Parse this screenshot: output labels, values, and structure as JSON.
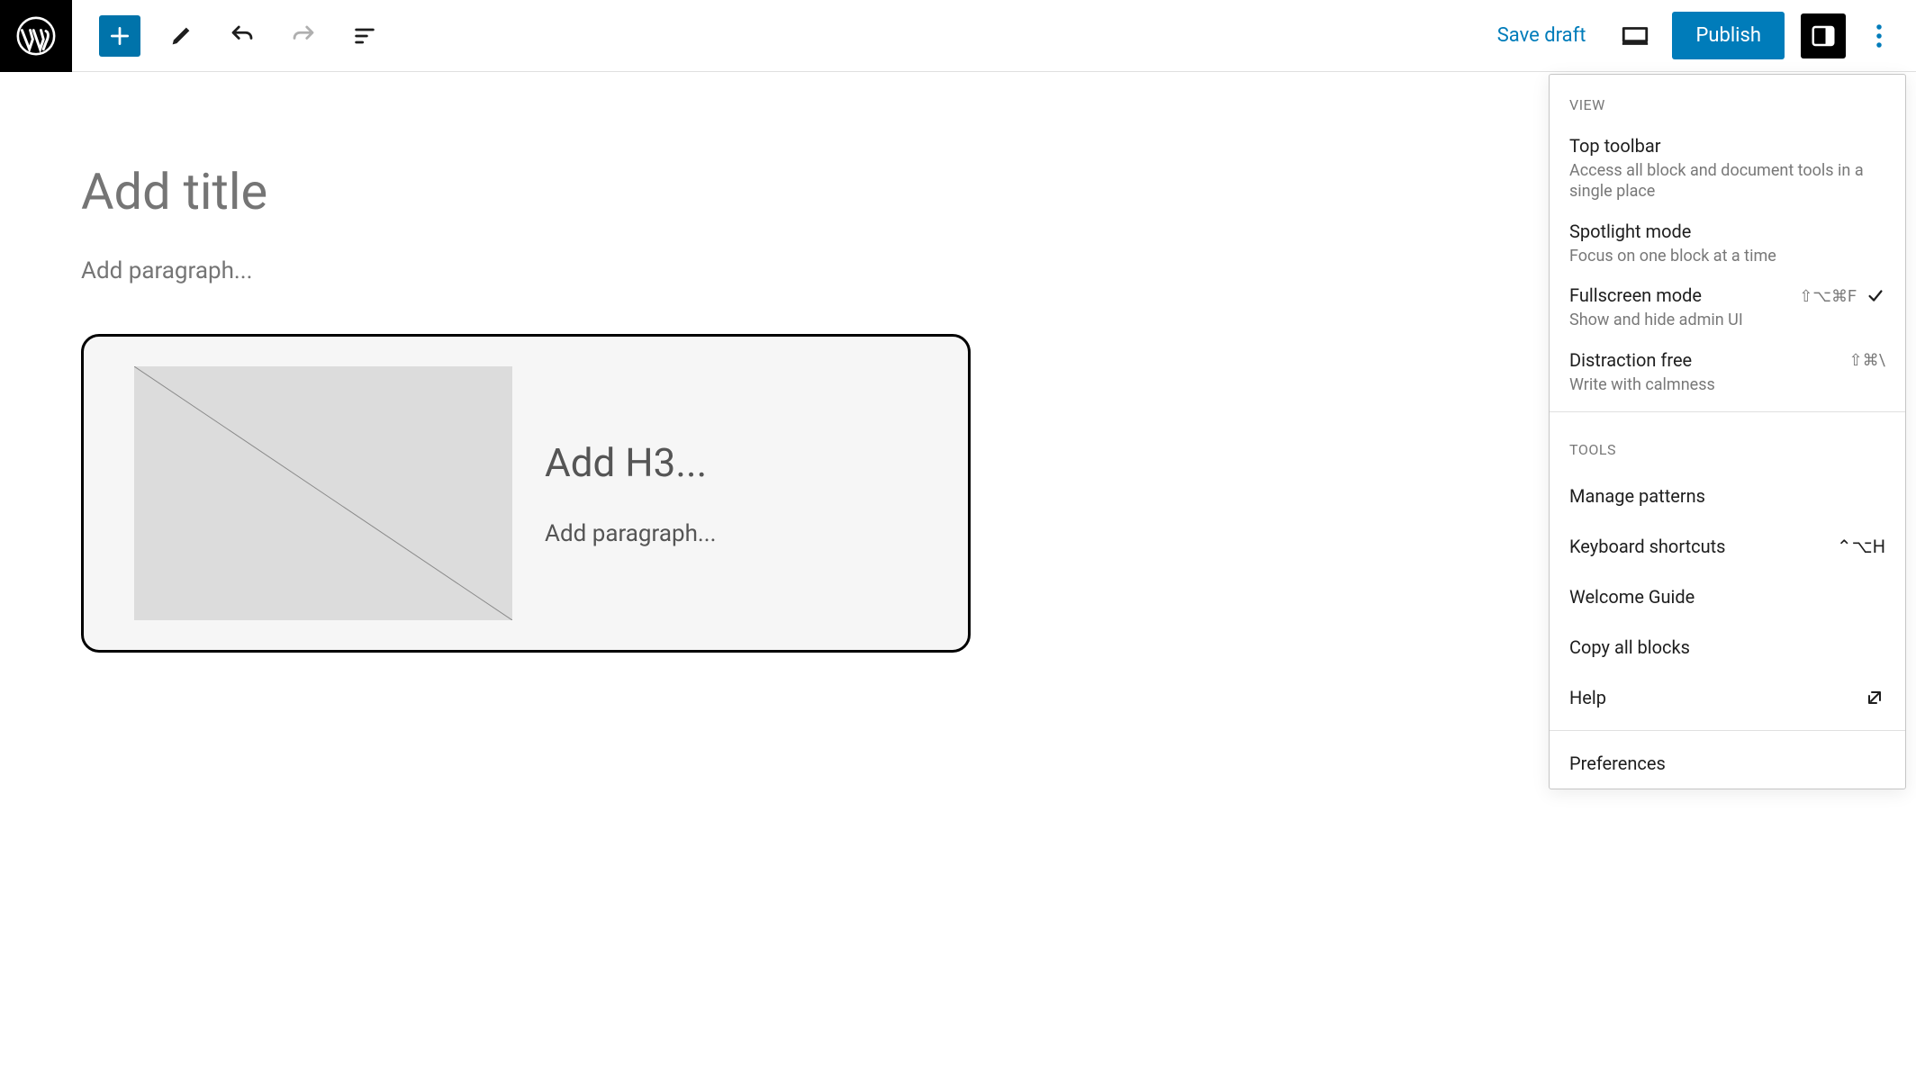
{
  "toolbar": {
    "save_draft": "Save draft",
    "publish": "Publish"
  },
  "editor": {
    "title_placeholder": "Add title",
    "paragraph_placeholder": "Add paragraph...",
    "h3_placeholder": "Add H3...",
    "inner_paragraph_placeholder": "Add paragraph..."
  },
  "menu": {
    "view_label": "VIEW",
    "tools_label": "TOOLS",
    "top_toolbar": {
      "title": "Top toolbar",
      "desc": "Access all block and document tools in a single place"
    },
    "spotlight": {
      "title": "Spotlight mode",
      "desc": "Focus on one block at a time"
    },
    "fullscreen": {
      "title": "Fullscreen mode",
      "desc": "Show and hide admin UI",
      "shortcut": "⇧⌥⌘F"
    },
    "distraction_free": {
      "title": "Distraction free",
      "desc": "Write with calmness",
      "shortcut": "⇧⌘\\"
    },
    "manage_patterns": "Manage patterns",
    "keyboard_shortcuts": {
      "title": "Keyboard shortcuts",
      "shortcut": "⌃⌥H"
    },
    "welcome_guide": "Welcome Guide",
    "copy_all_blocks": "Copy all blocks",
    "help": "Help",
    "preferences": "Preferences"
  }
}
